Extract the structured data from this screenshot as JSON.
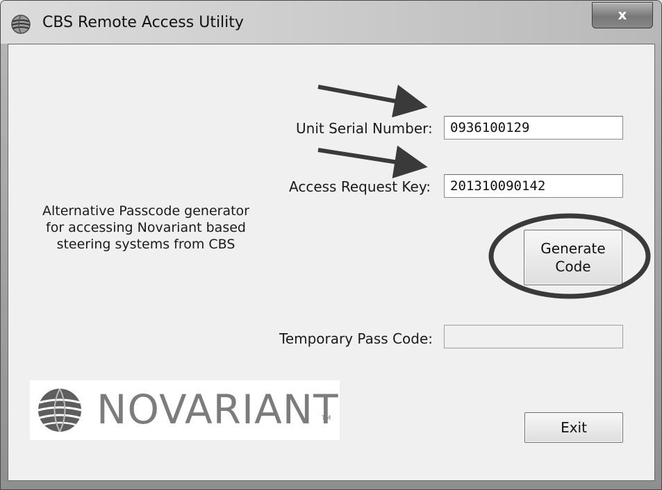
{
  "window": {
    "title": "CBS Remote Access Utility",
    "close_label": "x"
  },
  "form": {
    "serial_label": "Unit Serial Number:",
    "serial_value": "0936100129",
    "access_key_label": "Access Request Key:",
    "access_key_value": "201310090142",
    "passcode_label": "Temporary Pass Code:",
    "passcode_value": ""
  },
  "description": {
    "line1": "Alternative Passcode generator",
    "line2": "for accessing Novariant based",
    "line3": "steering systems from CBS"
  },
  "buttons": {
    "generate_line1": "Generate",
    "generate_line2": "Code",
    "exit": "Exit"
  },
  "logo": {
    "text": "NOVARIANT",
    "tm": "TM"
  },
  "annotations": {
    "arrow_color": "#3a3a3a",
    "circle_color": "#3a3a3a"
  }
}
